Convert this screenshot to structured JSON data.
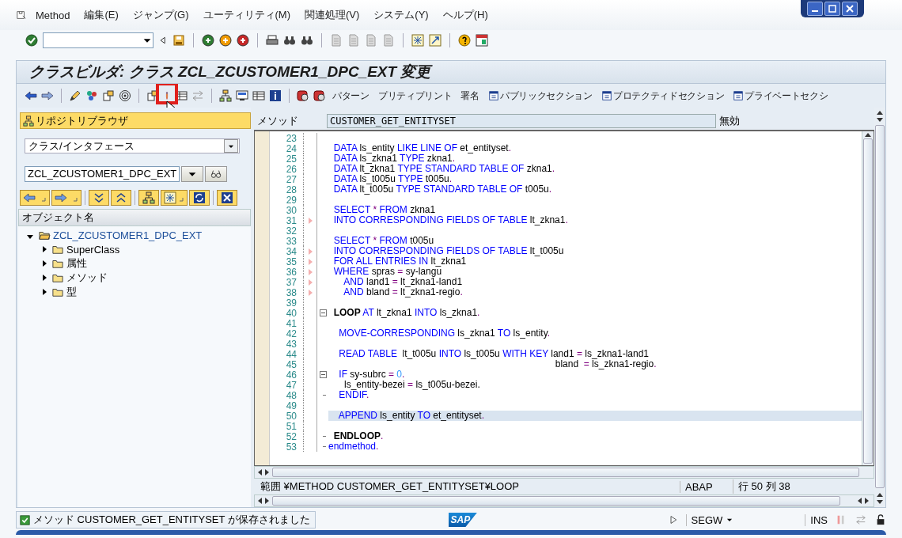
{
  "menu_bar": {
    "items": [
      "Method",
      "編集(E)",
      "ジャンプ(G)",
      "ユーティリティ(M)",
      "関連処理(V)",
      "システム(Y)",
      "ヘルプ(H)"
    ]
  },
  "window": {
    "title": "クラスビルダ: クラス ZCL_ZCUSTOMER1_DPC_EXT 変更"
  },
  "app_toolbar": {
    "text_buttons": [
      {
        "label": "パターン",
        "kind": "text"
      },
      {
        "label": "プリティプリント",
        "kind": "text"
      },
      {
        "label": "署名",
        "kind": "text"
      },
      {
        "label": "パブリックセクション",
        "kind": "section"
      },
      {
        "label": "プロテクティドセクション",
        "kind": "section"
      },
      {
        "label": "プライベートセクシ",
        "kind": "section"
      }
    ]
  },
  "repository_browser": {
    "title": "リポジトリブラウザ",
    "object_type": "クラス/インタフェース",
    "object_name": "ZCL_ZCUSTOMER1_DPC_EXT",
    "column_header": "オブジェクト名",
    "tree": [
      {
        "label": "ZCL_ZCUSTOMER1_DPC_EXT",
        "expanded": true,
        "children": [
          {
            "label": "SuperClass",
            "expanded": false
          },
          {
            "label": "属性",
            "expanded": false
          },
          {
            "label": "メソッド",
            "expanded": false
          },
          {
            "label": "型",
            "expanded": false
          }
        ]
      }
    ]
  },
  "method": {
    "label": "メソッド",
    "value": "CUSTOMER_GET_ENTITYSET",
    "status": "無効"
  },
  "code_lines": [
    {
      "number": "23",
      "flagged": false,
      "fold_start": false,
      "fold_end": false,
      "highlighted": false
    },
    {
      "number": "24",
      "flagged": false,
      "fold_start": false,
      "fold_end": false,
      "highlighted": false,
      "tokens": [
        {
          "kind": "keyword",
          "text": "  DATA"
        },
        {
          "kind": "plain",
          "text": " ls_entity "
        },
        {
          "kind": "keyword",
          "text": "LIKE LINE OF"
        },
        {
          "kind": "plain",
          "text": " et_entityset"
        },
        {
          "kind": "operator",
          "text": "."
        }
      ]
    },
    {
      "number": "25",
      "flagged": false,
      "fold_start": false,
      "fold_end": false,
      "highlighted": false,
      "tokens": [
        {
          "kind": "keyword",
          "text": "  DATA"
        },
        {
          "kind": "plain",
          "text": " ls_zkna1 "
        },
        {
          "kind": "keyword",
          "text": "TYPE"
        },
        {
          "kind": "plain",
          "text": " zkna1"
        },
        {
          "kind": "operator",
          "text": "."
        }
      ]
    },
    {
      "number": "26",
      "flagged": false,
      "fold_start": false,
      "fold_end": false,
      "highlighted": false,
      "tokens": [
        {
          "kind": "keyword",
          "text": "  DATA"
        },
        {
          "kind": "plain",
          "text": " lt_zkna1 "
        },
        {
          "kind": "keyword",
          "text": "TYPE STANDARD TABLE OF"
        },
        {
          "kind": "plain",
          "text": " zkna1"
        },
        {
          "kind": "operator",
          "text": "."
        }
      ]
    },
    {
      "number": "27",
      "flagged": false,
      "fold_start": false,
      "fold_end": false,
      "highlighted": false,
      "tokens": [
        {
          "kind": "keyword",
          "text": "  DATA"
        },
        {
          "kind": "plain",
          "text": " ls_t005u "
        },
        {
          "kind": "keyword",
          "text": "TYPE"
        },
        {
          "kind": "plain",
          "text": " t005u"
        },
        {
          "kind": "operator",
          "text": "."
        }
      ]
    },
    {
      "number": "28",
      "flagged": false,
      "fold_start": false,
      "fold_end": false,
      "highlighted": false,
      "tokens": [
        {
          "kind": "keyword",
          "text": "  DATA"
        },
        {
          "kind": "plain",
          "text": " lt_t005u "
        },
        {
          "kind": "keyword",
          "text": "TYPE STANDARD TABLE OF"
        },
        {
          "kind": "plain",
          "text": " t005u"
        },
        {
          "kind": "operator",
          "text": "."
        }
      ]
    },
    {
      "number": "29",
      "flagged": false,
      "fold_start": false,
      "fold_end": false,
      "highlighted": false
    },
    {
      "number": "30",
      "flagged": false,
      "fold_start": false,
      "fold_end": false,
      "highlighted": false,
      "tokens": [
        {
          "kind": "keyword",
          "text": "  SELECT "
        },
        {
          "kind": "operator",
          "text": "*"
        },
        {
          "kind": "keyword",
          "text": " FROM"
        },
        {
          "kind": "plain",
          "text": " zkna1"
        }
      ]
    },
    {
      "number": "31",
      "flagged": true,
      "fold_start": false,
      "fold_end": false,
      "highlighted": false,
      "tokens": [
        {
          "kind": "keyword",
          "text": "  INTO CORRESPONDING FIELDS OF TABLE"
        },
        {
          "kind": "plain",
          "text": " lt_zkna1"
        },
        {
          "kind": "operator",
          "text": "."
        }
      ]
    },
    {
      "number": "32",
      "flagged": false,
      "fold_start": false,
      "fold_end": false,
      "highlighted": false
    },
    {
      "number": "33",
      "flagged": false,
      "fold_start": false,
      "fold_end": false,
      "highlighted": false,
      "tokens": [
        {
          "kind": "keyword",
          "text": "  SELECT "
        },
        {
          "kind": "operator",
          "text": "*"
        },
        {
          "kind": "keyword",
          "text": " FROM"
        },
        {
          "kind": "plain",
          "text": " t005u"
        }
      ]
    },
    {
      "number": "34",
      "flagged": true,
      "fold_start": false,
      "fold_end": false,
      "highlighted": false,
      "tokens": [
        {
          "kind": "keyword",
          "text": "  INTO CORRESPONDING FIELDS OF TABLE"
        },
        {
          "kind": "plain",
          "text": " lt_t005u"
        }
      ]
    },
    {
      "number": "35",
      "flagged": true,
      "fold_start": false,
      "fold_end": false,
      "highlighted": false,
      "tokens": [
        {
          "kind": "keyword",
          "text": "  FOR ALL ENTRIES IN"
        },
        {
          "kind": "plain",
          "text": " lt_zkna1"
        }
      ]
    },
    {
      "number": "36",
      "flagged": true,
      "fold_start": false,
      "fold_end": false,
      "highlighted": false,
      "tokens": [
        {
          "kind": "keyword",
          "text": "  WHERE"
        },
        {
          "kind": "plain",
          "text": " spras "
        },
        {
          "kind": "operator",
          "text": "="
        },
        {
          "kind": "plain",
          "text": " sy-langu"
        }
      ]
    },
    {
      "number": "37",
      "flagged": true,
      "fold_start": false,
      "fold_end": false,
      "highlighted": false,
      "tokens": [
        {
          "kind": "keyword",
          "text": "      AND"
        },
        {
          "kind": "plain",
          "text": " land1 "
        },
        {
          "kind": "operator",
          "text": "="
        },
        {
          "kind": "plain",
          "text": " lt_zkna1-land1"
        }
      ]
    },
    {
      "number": "38",
      "flagged": true,
      "fold_start": false,
      "fold_end": false,
      "highlighted": false,
      "tokens": [
        {
          "kind": "keyword",
          "text": "      AND"
        },
        {
          "kind": "plain",
          "text": " bland "
        },
        {
          "kind": "operator",
          "text": "="
        },
        {
          "kind": "plain",
          "text": " lt_zkna1-regio"
        },
        {
          "kind": "operator",
          "text": "."
        }
      ]
    },
    {
      "number": "39",
      "flagged": false,
      "fold_start": false,
      "fold_end": false,
      "highlighted": false
    },
    {
      "number": "40",
      "flagged": false,
      "fold_start": true,
      "fold_end": false,
      "highlighted": false,
      "tokens": [
        {
          "kind": "statement",
          "text": "  LOOP"
        },
        {
          "kind": "keyword",
          "text": " AT"
        },
        {
          "kind": "plain",
          "text": " lt_zkna1 "
        },
        {
          "kind": "keyword",
          "text": "INTO"
        },
        {
          "kind": "plain",
          "text": " ls_zkna1"
        },
        {
          "kind": "operator",
          "text": "."
        }
      ]
    },
    {
      "number": "41",
      "flagged": false,
      "fold_start": false,
      "fold_end": false,
      "highlighted": false
    },
    {
      "number": "42",
      "flagged": false,
      "fold_start": false,
      "fold_end": false,
      "highlighted": false,
      "tokens": [
        {
          "kind": "keyword",
          "text": "    MOVE-CORRESPONDING"
        },
        {
          "kind": "plain",
          "text": " ls_zkna1 "
        },
        {
          "kind": "keyword",
          "text": "TO"
        },
        {
          "kind": "plain",
          "text": " ls_entity"
        },
        {
          "kind": "operator",
          "text": "."
        }
      ]
    },
    {
      "number": "43",
      "flagged": false,
      "fold_start": false,
      "fold_end": false,
      "highlighted": false
    },
    {
      "number": "44",
      "flagged": false,
      "fold_start": false,
      "fold_end": false,
      "highlighted": false,
      "tokens": [
        {
          "kind": "keyword",
          "text": "    READ TABLE"
        },
        {
          "kind": "plain",
          "text": "  lt_t005u "
        },
        {
          "kind": "keyword",
          "text": "INTO"
        },
        {
          "kind": "plain",
          "text": " ls_t005u "
        },
        {
          "kind": "keyword",
          "text": "WITH KEY"
        },
        {
          "kind": "plain",
          "text": " land1 "
        },
        {
          "kind": "operator",
          "text": "="
        },
        {
          "kind": "plain",
          "text": " ls_zkna1-land1"
        }
      ]
    },
    {
      "number": "45",
      "flagged": false,
      "fold_start": false,
      "fold_end": false,
      "highlighted": false,
      "tokens": [
        {
          "kind": "plain",
          "text": "                                                                                      bland  "
        },
        {
          "kind": "operator",
          "text": "="
        },
        {
          "kind": "plain",
          "text": " ls_zkna1-regio"
        },
        {
          "kind": "operator",
          "text": "."
        }
      ]
    },
    {
      "number": "46",
      "flagged": false,
      "fold_start": true,
      "fold_end": false,
      "highlighted": false,
      "tokens": [
        {
          "kind": "keyword",
          "text": "    IF"
        },
        {
          "kind": "plain",
          "text": " sy-subrc "
        },
        {
          "kind": "operator",
          "text": "= "
        },
        {
          "kind": "number",
          "text": "0"
        },
        {
          "kind": "operator",
          "text": "."
        }
      ]
    },
    {
      "number": "47",
      "flagged": false,
      "fold_start": false,
      "fold_end": false,
      "highlighted": false,
      "tokens": [
        {
          "kind": "plain",
          "text": "      ls_entity-bezei "
        },
        {
          "kind": "operator",
          "text": "="
        },
        {
          "kind": "plain",
          "text": " ls_t005u-bezei."
        }
      ]
    },
    {
      "number": "48",
      "flagged": false,
      "fold_start": false,
      "fold_end": true,
      "highlighted": false,
      "tokens": [
        {
          "kind": "keyword",
          "text": "    ENDIF"
        },
        {
          "kind": "operator",
          "text": "."
        }
      ]
    },
    {
      "number": "49",
      "flagged": false,
      "fold_start": false,
      "fold_end": false,
      "highlighted": false
    },
    {
      "number": "50",
      "flagged": false,
      "fold_start": false,
      "fold_end": false,
      "highlighted": true,
      "tokens": [
        {
          "kind": "keyword",
          "text": "    APPEND"
        },
        {
          "kind": "plain",
          "text": " ls_entity "
        },
        {
          "kind": "keyword",
          "text": "TO"
        },
        {
          "kind": "plain",
          "text": " et_entityset"
        },
        {
          "kind": "operator",
          "text": "."
        }
      ]
    },
    {
      "number": "51",
      "flagged": false,
      "fold_start": false,
      "fold_end": false,
      "highlighted": false
    },
    {
      "number": "52",
      "flagged": false,
      "fold_start": false,
      "fold_end": true,
      "highlighted": false,
      "tokens": [
        {
          "kind": "statement",
          "text": "  ENDLOOP"
        },
        {
          "kind": "operator",
          "text": "."
        }
      ]
    },
    {
      "number": "53",
      "flagged": false,
      "fold_start": false,
      "fold_end": true,
      "highlighted": false,
      "tokens": [
        {
          "kind": "keyword",
          "text": "endmethod"
        },
        {
          "kind": "operator",
          "text": "."
        }
      ]
    }
  ],
  "editor_info": {
    "scope": "範囲 ¥METHOD CUSTOMER_GET_ENTITYSET¥LOOP",
    "language": "ABAP",
    "position": "行 50 列 38"
  },
  "status_bar": {
    "message": "メソッド CUSTOMER_GET_ENTITYSET が保存されました",
    "logo": "SAP",
    "transaction": "SEGW",
    "mode": "INS"
  }
}
